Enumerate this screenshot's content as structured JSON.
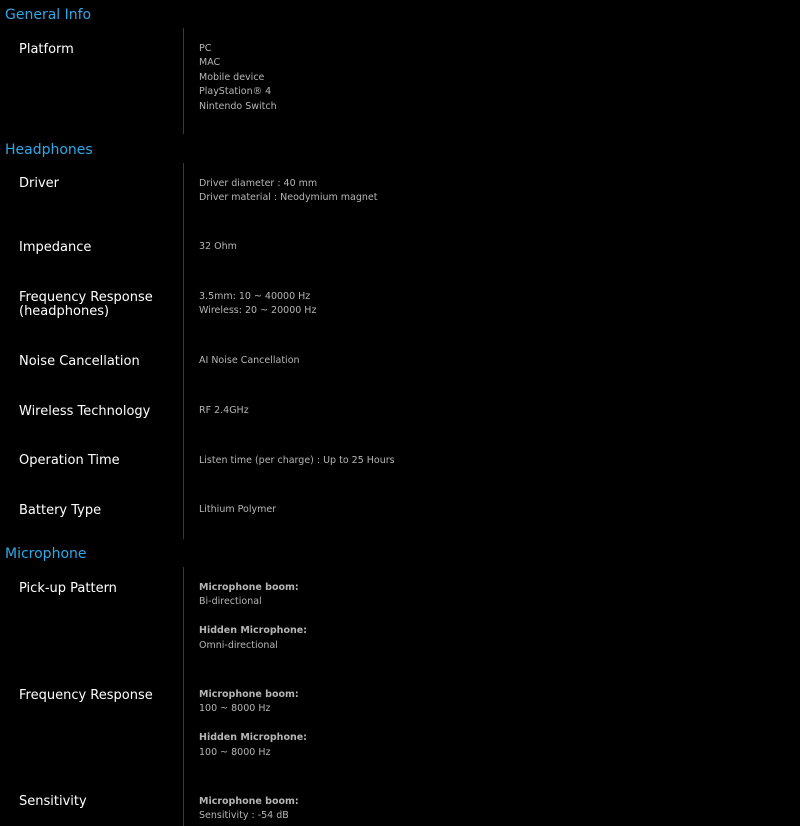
{
  "colors": {
    "background": "#000000",
    "section_title": "#2fa8e8",
    "label": "#ffffff",
    "value": "#b5b5b5",
    "divider": "#3a3a3a"
  },
  "general": {
    "title": "General Info",
    "platform": {
      "label": "Platform",
      "values": [
        "PC",
        "MAC",
        "Mobile device",
        "PlayStation® 4",
        "Nintendo Switch"
      ]
    }
  },
  "headphones": {
    "title": "Headphones",
    "driver": {
      "label": "Driver",
      "values": [
        "Driver diameter : 40 mm",
        "Driver material : Neodymium magnet"
      ]
    },
    "impedance": {
      "label": "Impedance",
      "values": [
        "32 Ohm"
      ]
    },
    "frequency": {
      "label": "Frequency Response (headphones)",
      "values": [
        "3.5mm: 10 ~ 40000 Hz",
        "Wireless: 20 ~ 20000 Hz"
      ]
    },
    "noise": {
      "label": "Noise Cancellation",
      "values": [
        "AI Noise Cancellation"
      ]
    },
    "wireless": {
      "label": "Wireless Technology",
      "values": [
        "RF 2.4GHz"
      ]
    },
    "operation": {
      "label": "Operation Time",
      "values": [
        "Listen time (per charge) : Up to 25 Hours"
      ]
    },
    "battery": {
      "label": "Battery Type",
      "values": [
        "Lithium Polymer"
      ]
    }
  },
  "microphone": {
    "title": "Microphone",
    "pickup": {
      "label": "Pick-up Pattern",
      "boom_head": "Microphone boom:",
      "boom_value": "Bi-directional",
      "hidden_head": "Hidden Microphone:",
      "hidden_value": "Omni-directional"
    },
    "frequency": {
      "label": "Frequency Response",
      "boom_head": "Microphone boom:",
      "boom_value": "100 ~ 8000 Hz",
      "hidden_head": "Hidden Microphone:",
      "hidden_value": "100 ~ 8000 Hz"
    },
    "sensitivity": {
      "label": "Sensitivity",
      "boom_head": "Microphone boom:",
      "boom_value": "Sensitivity : -54 dB"
    }
  }
}
